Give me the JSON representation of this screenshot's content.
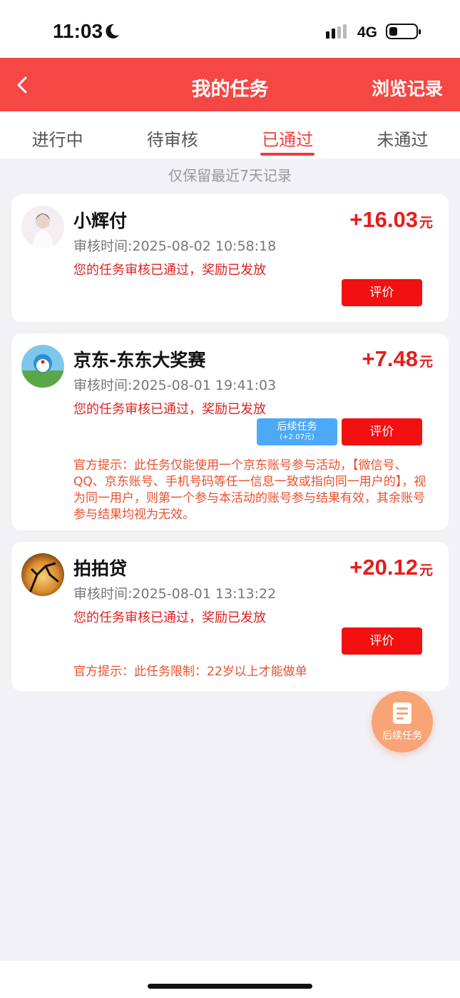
{
  "status_bar": {
    "time": "11:03",
    "network": "4G"
  },
  "header": {
    "title": "我的任务",
    "history_label": "浏览记录"
  },
  "tabs": [
    {
      "label": "进行中",
      "active": false
    },
    {
      "label": "待审核",
      "active": false
    },
    {
      "label": "已通过",
      "active": true
    },
    {
      "label": "未通过",
      "active": false
    }
  ],
  "notice": "仅保留最近7天记录",
  "tasks": [
    {
      "title": "小辉付",
      "amount": "+16.03",
      "unit": "元",
      "review_time": "审核时间:2025-08-02 10:58:18",
      "status": "您的任务审核已通过，奖励已发放",
      "rate_label": "评价"
    },
    {
      "title": "京东-东东大奖赛",
      "amount": "+7.48",
      "unit": "元",
      "review_time": "审核时间:2025-08-01 19:41:03",
      "status": "您的任务审核已通过，奖励已发放",
      "followup_label": "后续任务",
      "followup_reward": "(+2.07元)",
      "rate_label": "评价",
      "tip": "官方提示：此任务仅能使用一个京东账号参与活动，【微信号、QQ、京东账号、手机号码等任一信息一致或指向同一用户的】，视为同一用户，则第一个参与本活动的账号参与结果有效，其余账号参与结果均视为无效。"
    },
    {
      "title": "拍拍贷",
      "amount": "+20.12",
      "unit": "元",
      "review_time": "审核时间:2025-08-01 13:13:22",
      "status": "您的任务审核已通过，奖励已发放",
      "rate_label": "评价",
      "tip": "官方提示：此任务限制：22岁以上才能做单"
    }
  ],
  "float_button": {
    "label": "后续任务"
  },
  "colors": {
    "header": "#f54744",
    "accent": "#f21010",
    "followup": "#4ca9f8"
  }
}
